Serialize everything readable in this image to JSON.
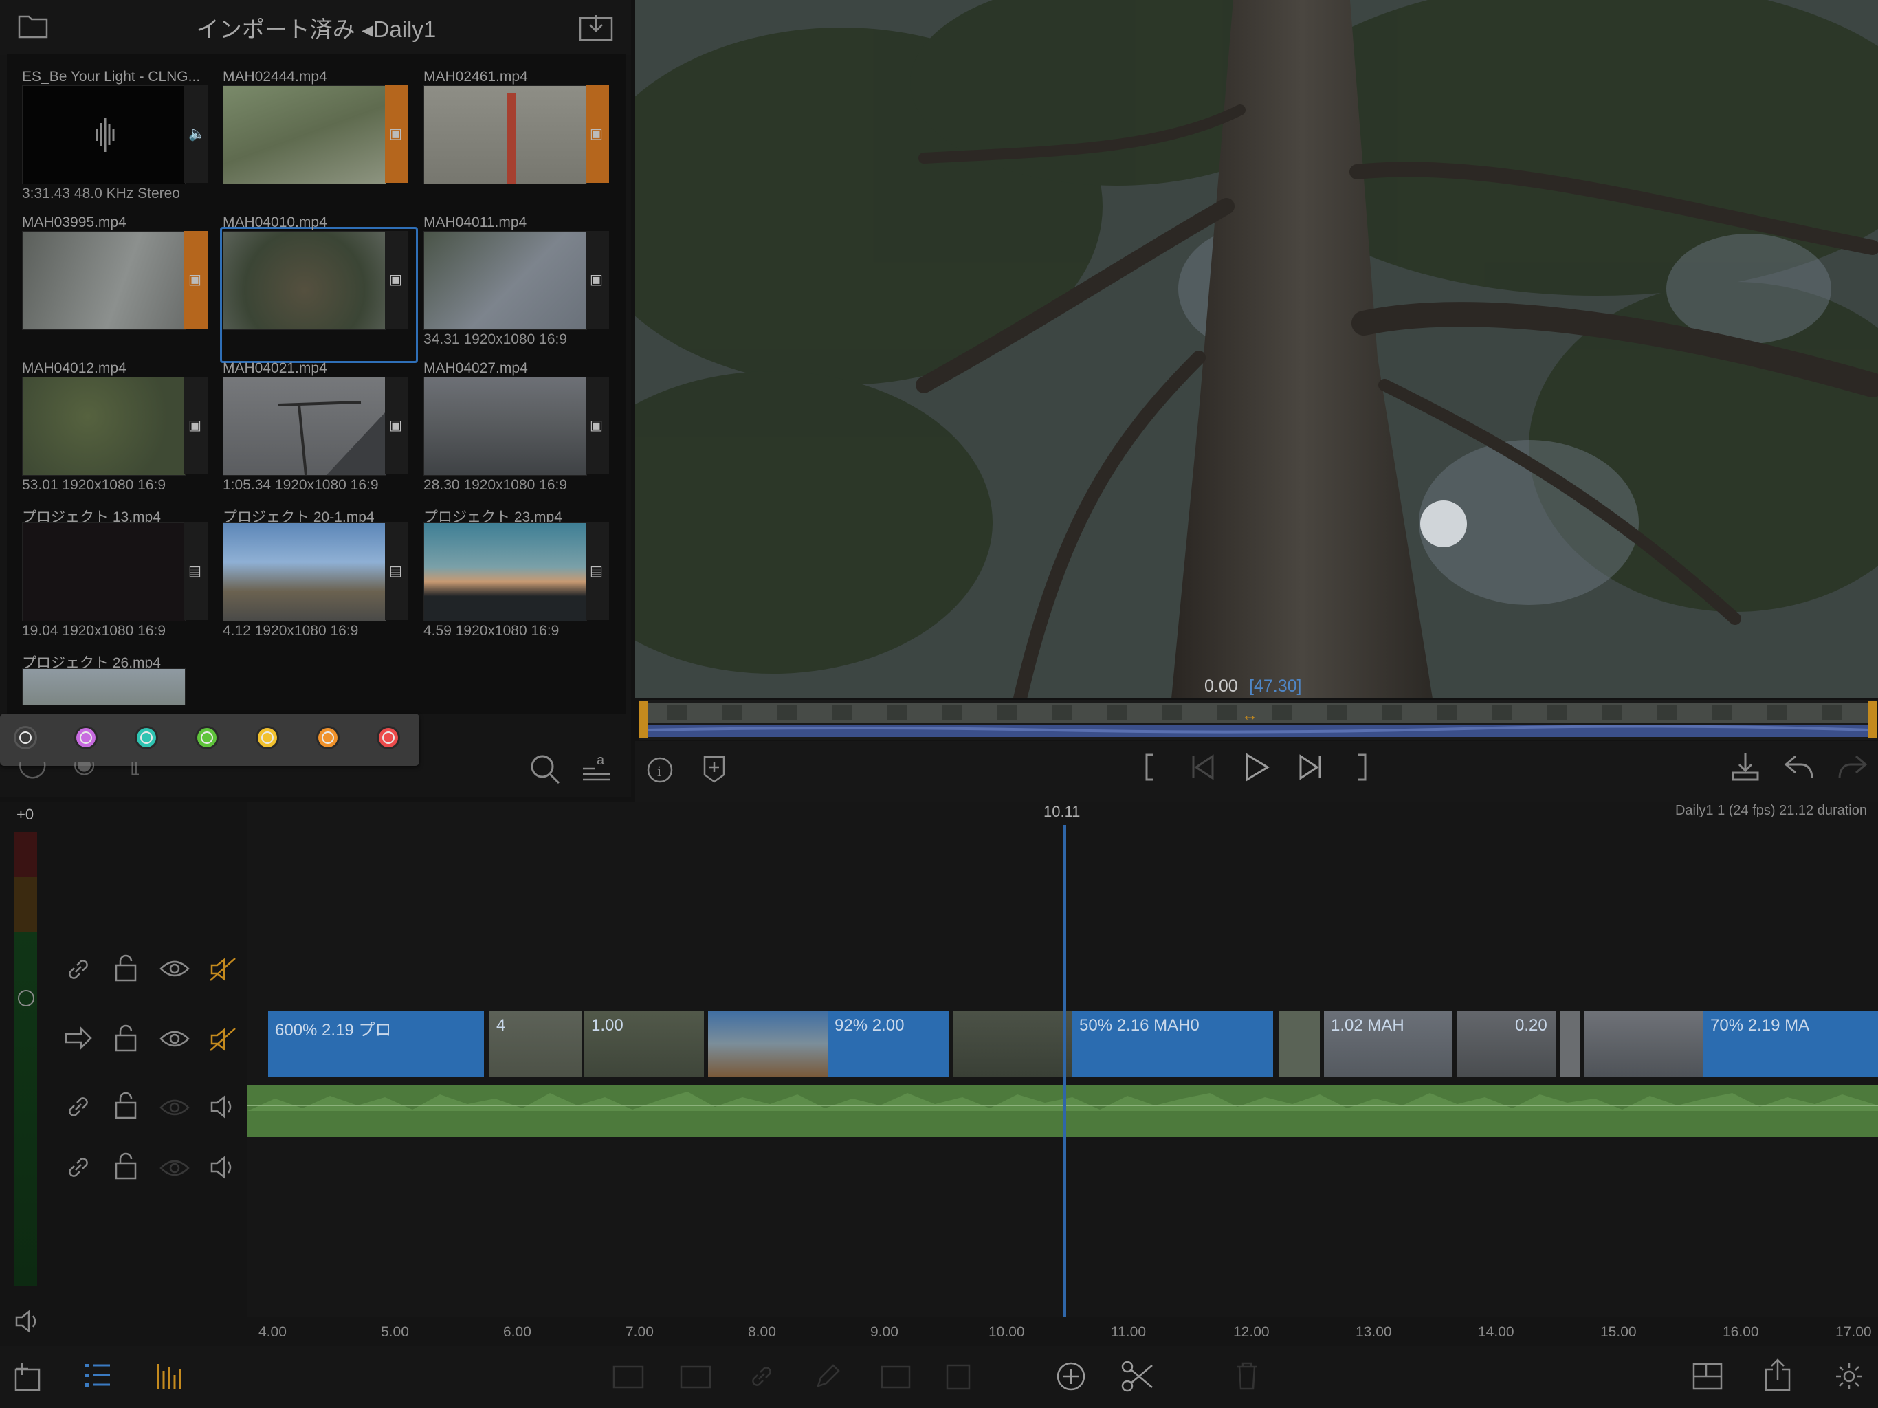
{
  "browser": {
    "title": "インポート済み ◂Daily1",
    "clips": [
      {
        "name": "ES_Be Your Light - CLNG...",
        "meta": "3:31.43  48.0 KHz  Stereo",
        "side_icon": "speaker-icon"
      },
      {
        "name": "MAH02444.mp4",
        "meta": "",
        "side_icon": "clip-icon"
      },
      {
        "name": "MAH02461.mp4",
        "meta": "",
        "side_icon": "clip-icon"
      },
      {
        "name": "MAH03995.mp4",
        "meta": "",
        "side_icon": "clip-icon"
      },
      {
        "name": "MAH04010.mp4",
        "meta": "",
        "side_icon": "clip-icon"
      },
      {
        "name": "MAH04011.mp4",
        "meta": "34.31  1920x1080  16:9",
        "side_icon": "clip-icon"
      },
      {
        "name": "MAH04012.mp4",
        "meta": "53.01  1920x1080  16:9",
        "side_icon": "clip-icon"
      },
      {
        "name": "MAH04021.mp4",
        "meta": "1:05.34  1920x1080  16:9",
        "side_icon": "clip-icon"
      },
      {
        "name": "MAH04027.mp4",
        "meta": "28.30  1920x1080  16:9",
        "side_icon": "clip-icon"
      },
      {
        "name": "プロジェクト 13.mp4",
        "meta": "19.04  1920x1080  16:9",
        "side_icon": "film-icon"
      },
      {
        "name": "プロジェクト 20-1.mp4",
        "meta": "4.12  1920x1080  16:9",
        "side_icon": "film-icon"
      },
      {
        "name": "プロジェクト 23.mp4",
        "meta": "4.59  1920x1080  16:9",
        "side_icon": "film-icon"
      },
      {
        "name": "プロジェクト 26.mp4",
        "meta": "",
        "side_icon": "film-icon"
      }
    ],
    "selected_clip": "MAH04010.mp4",
    "color_tags": [
      "#3a3a3a",
      "#c86be0",
      "#2fc4b2",
      "#5fc43b",
      "#f2c12e",
      "#f0922b",
      "#ec4b4b"
    ]
  },
  "viewer": {
    "timecode": "0.00",
    "duration": "[47.30]"
  },
  "timeline": {
    "level_label": "+0",
    "playhead_time": "10.11",
    "info": "Daily1 1 (24 fps)  21.12 duration",
    "ruler": [
      "4.00",
      "5.00",
      "6.00",
      "7.00",
      "8.00",
      "9.00",
      "10.00",
      "11.00",
      "12.00",
      "13.00",
      "14.00",
      "15.00",
      "16.00",
      "17.00"
    ],
    "clip_labels": [
      "600%  2.19  プロ",
      "4",
      "1.00",
      "92%  2.00",
      "50%  2.16  MAH0",
      "1.02  MAH",
      "0.20",
      "70%  2.19  MA"
    ]
  },
  "colors": {
    "accent_blue": "#2b6cb0",
    "audio_green": "#4d7a3c",
    "mute_orange": "#c48a1e"
  }
}
